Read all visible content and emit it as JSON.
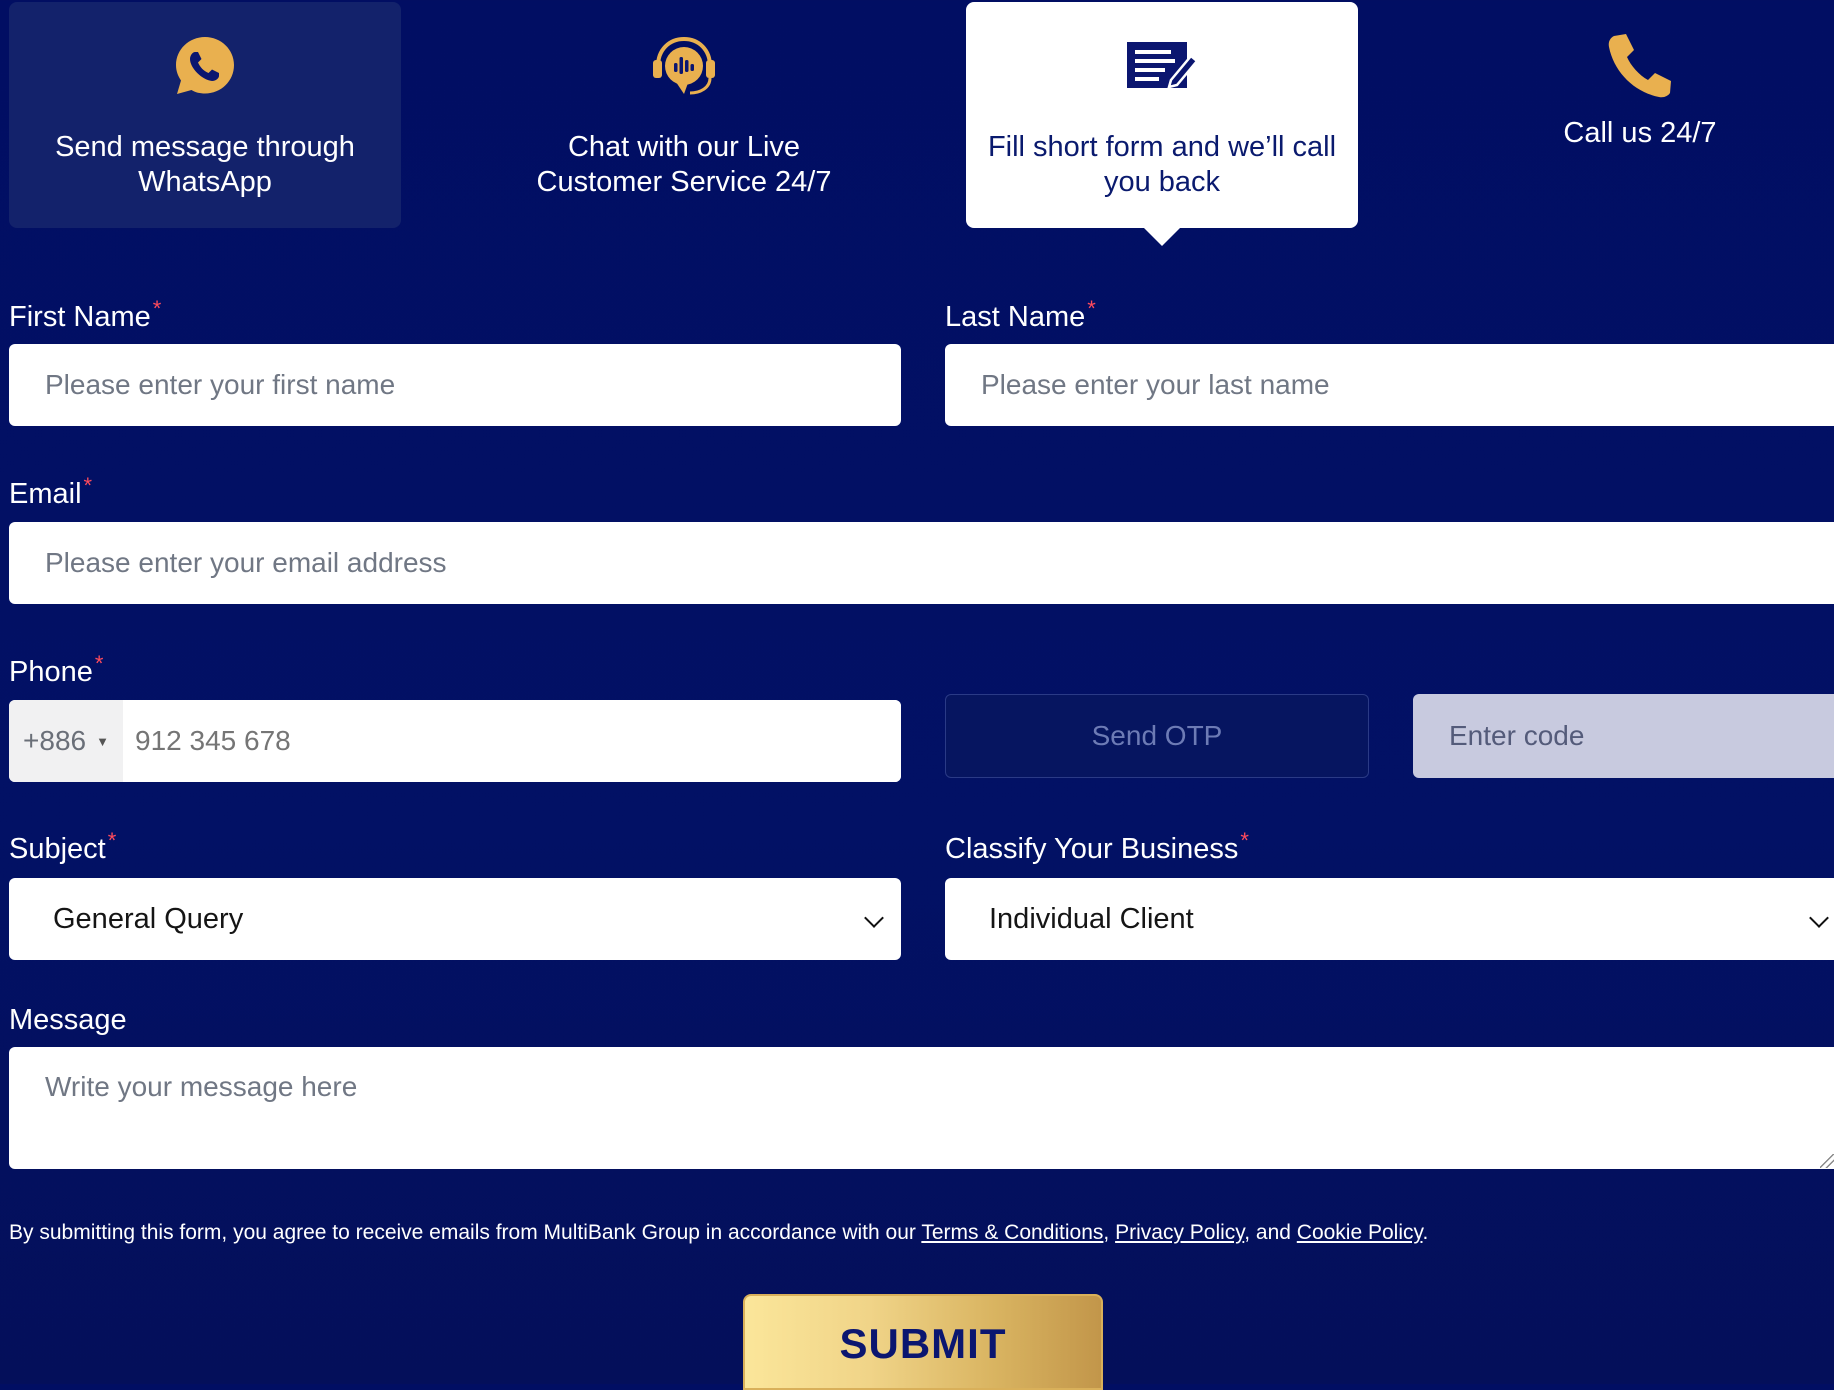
{
  "contact_options": [
    {
      "label": "Send message through WhatsApp",
      "icon": "whatsapp-icon"
    },
    {
      "label": "Chat with our Live Customer Service 24/7",
      "icon": "headset-chat-icon"
    },
    {
      "label": "Fill short form and we’ll call you back",
      "icon": "form-edit-icon"
    },
    {
      "label": "Call us 24/7",
      "icon": "phone-icon"
    }
  ],
  "form": {
    "required_mark": "*",
    "first_name": {
      "label": "First Name",
      "placeholder": "Please enter your first name"
    },
    "last_name": {
      "label": "Last Name",
      "placeholder": "Please enter your last name"
    },
    "email": {
      "label": "Email",
      "placeholder": "Please enter your email address"
    },
    "phone": {
      "label": "Phone",
      "country_code": "+886",
      "placeholder": "912 345 678"
    },
    "otp": {
      "button_label": "Send OTP",
      "placeholder": "Enter code"
    },
    "subject": {
      "label": "Subject",
      "value": "General Query"
    },
    "business": {
      "label": "Classify Your Business",
      "value": "Individual Client"
    },
    "message": {
      "label": "Message",
      "placeholder": "Write your message here"
    },
    "consent": {
      "prefix": "By submitting this form, you agree to receive emails from MultiBank Group in accordance with our ",
      "terms": "Terms & Conditions",
      "sep1": ", ",
      "privacy": "Privacy Policy",
      "sep2": ", and ",
      "cookie": "Cookie Policy",
      "suffix": "."
    },
    "submit_label": "SUBMIT"
  },
  "colors": {
    "background": "#000f66",
    "accent_gold": "#e9b04f",
    "active_card": "#ffffff",
    "inactive_card": "#13226b",
    "required": "#ff4b5c"
  }
}
